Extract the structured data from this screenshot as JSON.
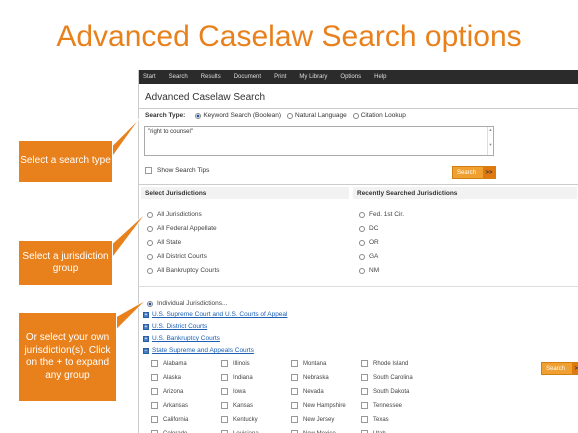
{
  "slide": {
    "title": "Advanced Caselaw Search options",
    "callouts": {
      "search_type": "Select a search type",
      "jurisdiction_group": "Select a jurisdiction group",
      "own_jurisdiction": "Or select your own jurisdiction(s). Click on the + to expand any group"
    }
  },
  "nav": [
    "Start",
    "Search",
    "Results",
    "Document",
    "Print",
    "My Library",
    "Options",
    "Help"
  ],
  "page": {
    "heading": "Advanced Caselaw Search",
    "search_type_label": "Search Type:",
    "search_types": [
      {
        "label": "Keyword Search (Boolean)",
        "selected": true
      },
      {
        "label": "Natural Language",
        "selected": false
      },
      {
        "label": "Citation Lookup",
        "selected": false
      }
    ],
    "query": "\"right to counsel\"",
    "show_tips": "Show Search Tips",
    "search_button": "Search",
    "search_arrow": ">>"
  },
  "jurisdictions": {
    "select_heading": "Select Jurisdictions",
    "recent_heading": "Recently Searched Jurisdictions",
    "groups": [
      "All Jurisdictions",
      "All Federal Appellate",
      "All State",
      "All District Courts",
      "All Bankruptcy Courts"
    ],
    "recent": [
      "Fed. 1st Cir.",
      "DC",
      "OR",
      "GA",
      "NM"
    ],
    "individual": "Individual Jurisdictions...",
    "expandable": [
      "U.S. Supreme Court and U.S. Courts of Appeal",
      "U.S. District Courts",
      "U.S. Bankruptcy Courts",
      "State Supreme and Appeals Courts"
    ],
    "states": [
      [
        "Alabama",
        "Alaska",
        "Arizona",
        "Arkansas",
        "California",
        "Colorado"
      ],
      [
        "Illinois",
        "Indiana",
        "Iowa",
        "Kansas",
        "Kentucky",
        "Louisiana"
      ],
      [
        "Montana",
        "Nebraska",
        "Nevada",
        "New Hampshire",
        "New Jersey",
        "New Mexico"
      ],
      [
        "Rhode Island",
        "South Carolina",
        "South Dakota",
        "Tennessee",
        "Texas",
        "Utah"
      ]
    ]
  },
  "colors": {
    "accent": "#e8801c",
    "nav_bg": "#2b2b2b",
    "link": "#1a5fb4"
  }
}
